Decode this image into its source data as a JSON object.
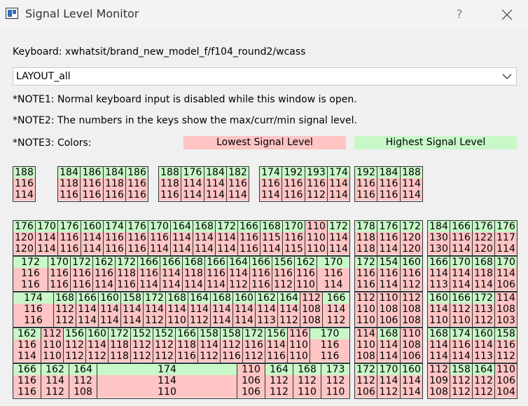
{
  "window": {
    "title": "Signal Level Monitor",
    "help_label": "?"
  },
  "keyboard_label": "Keyboard: xwhatsit/brand_new_model_f/f104_round2/wcass",
  "layout_select": {
    "value": "LAYOUT_all"
  },
  "notes": {
    "n1": "*NOTE1: Normal keyboard input is disabled while this window is open.",
    "n2": "*NOTE2: The numbers in the keys show the max/curr/min signal level.",
    "n3": "*NOTE3: Colors:"
  },
  "legend": {
    "lowest": "Lowest Signal Level",
    "highest": "Highest Signal Level",
    "low_color": "#ffc4c4",
    "high_color": "#c8f7c8"
  },
  "keys": [
    [
      18,
      237,
      32,
      "188",
      "116",
      "114"
    ],
    [
      82,
      237,
      32,
      "184",
      "118",
      "116"
    ],
    [
      114,
      237,
      33,
      "186",
      "116",
      "116"
    ],
    [
      147,
      237,
      32,
      "184",
      "118",
      "116"
    ],
    [
      179,
      237,
      32,
      "186",
      "116",
      "116"
    ],
    [
      226,
      237,
      32,
      "188",
      "118",
      "116"
    ],
    [
      258,
      237,
      33,
      "176",
      "114",
      "114"
    ],
    [
      291,
      237,
      32,
      "184",
      "114",
      "114"
    ],
    [
      323,
      237,
      32,
      "182",
      "116",
      "114"
    ],
    [
      370,
      237,
      32,
      "174",
      "116",
      "114"
    ],
    [
      402,
      237,
      33,
      "192",
      "116",
      "116"
    ],
    [
      435,
      237,
      32,
      "193",
      "116",
      "112"
    ],
    [
      467,
      237,
      32,
      "174",
      "114",
      "114"
    ],
    [
      506,
      237,
      32,
      "192",
      "116",
      "116"
    ],
    [
      538,
      237,
      33,
      "184",
      "116",
      "116"
    ],
    [
      571,
      237,
      32,
      "188",
      "114",
      "114"
    ],
    [
      18,
      314,
      32,
      "176",
      "120",
      "120"
    ],
    [
      50,
      314,
      32,
      "170",
      "114",
      "114"
    ],
    [
      82,
      314,
      33,
      "176",
      "116",
      "116"
    ],
    [
      115,
      314,
      32,
      "160",
      "114",
      "114"
    ],
    [
      147,
      314,
      32,
      "174",
      "116",
      "116"
    ],
    [
      179,
      314,
      32,
      "176",
      "116",
      "116"
    ],
    [
      211,
      314,
      32,
      "170",
      "116",
      "114"
    ],
    [
      243,
      314,
      32,
      "164",
      "114",
      "114"
    ],
    [
      275,
      314,
      32,
      "168",
      "114",
      "114"
    ],
    [
      307,
      314,
      32,
      "172",
      "114",
      "114"
    ],
    [
      339,
      314,
      32,
      "166",
      "116",
      "116"
    ],
    [
      371,
      314,
      32,
      "168",
      "115",
      "114"
    ],
    [
      403,
      314,
      32,
      "170",
      "116",
      "115"
    ],
    [
      435,
      314,
      32,
      "110",
      "110",
      "110"
    ],
    [
      467,
      314,
      32,
      "172",
      "114",
      "114"
    ],
    [
      506,
      314,
      32,
      "178",
      "118",
      "118"
    ],
    [
      538,
      314,
      33,
      "176",
      "116",
      "114"
    ],
    [
      571,
      314,
      32,
      "172",
      "120",
      "120"
    ],
    [
      610,
      314,
      32,
      "184",
      "130",
      "130"
    ],
    [
      642,
      314,
      32,
      "166",
      "116",
      "114"
    ],
    [
      674,
      314,
      32,
      "176",
      "122",
      "120"
    ],
    [
      706,
      314,
      32,
      "176",
      "117",
      "114"
    ],
    [
      18,
      365,
      50,
      "172",
      "116",
      "116"
    ],
    [
      68,
      365,
      32,
      "170",
      "116",
      "116"
    ],
    [
      100,
      365,
      32,
      "172",
      "116",
      "116"
    ],
    [
      132,
      365,
      32,
      "162",
      "116",
      "114"
    ],
    [
      164,
      365,
      32,
      "172",
      "118",
      "116"
    ],
    [
      196,
      365,
      32,
      "166",
      "116",
      "114"
    ],
    [
      228,
      365,
      32,
      "166",
      "114",
      "114"
    ],
    [
      260,
      365,
      32,
      "168",
      "118",
      "114"
    ],
    [
      292,
      365,
      32,
      "166",
      "116",
      "114"
    ],
    [
      324,
      365,
      32,
      "164",
      "114",
      "112"
    ],
    [
      356,
      365,
      32,
      "166",
      "116",
      "116"
    ],
    [
      388,
      365,
      32,
      "156",
      "116",
      "112"
    ],
    [
      420,
      365,
      32,
      "162",
      "116",
      "110"
    ],
    [
      452,
      365,
      47,
      "170",
      "116",
      "114"
    ],
    [
      506,
      365,
      32,
      "172",
      "116",
      "116"
    ],
    [
      538,
      365,
      33,
      "154",
      "116",
      "114"
    ],
    [
      571,
      365,
      32,
      "160",
      "116",
      "112"
    ],
    [
      610,
      365,
      32,
      "166",
      "114",
      "113"
    ],
    [
      642,
      365,
      32,
      "170",
      "114",
      "114"
    ],
    [
      674,
      365,
      32,
      "168",
      "118",
      "114"
    ],
    [
      706,
      365,
      32,
      "170",
      "114",
      "106"
    ],
    [
      18,
      416,
      58,
      "174",
      "116",
      "116"
    ],
    [
      76,
      416,
      32,
      "168",
      "112",
      "112"
    ],
    [
      108,
      416,
      32,
      "166",
      "114",
      "114"
    ],
    [
      140,
      416,
      32,
      "160",
      "114",
      "114"
    ],
    [
      172,
      416,
      32,
      "158",
      "114",
      "114"
    ],
    [
      204,
      416,
      32,
      "172",
      "114",
      "112"
    ],
    [
      236,
      416,
      32,
      "168",
      "114",
      "110"
    ],
    [
      268,
      416,
      32,
      "164",
      "114",
      "112"
    ],
    [
      300,
      416,
      32,
      "168",
      "114",
      "114"
    ],
    [
      332,
      416,
      32,
      "160",
      "114",
      "114"
    ],
    [
      364,
      416,
      32,
      "162",
      "114",
      "113"
    ],
    [
      396,
      416,
      32,
      "164",
      "114",
      "112"
    ],
    [
      428,
      416,
      32,
      "112",
      "108",
      "108"
    ],
    [
      460,
      416,
      39,
      "166",
      "114",
      "112"
    ],
    [
      506,
      416,
      32,
      "112",
      "110",
      "110"
    ],
    [
      538,
      416,
      33,
      "110",
      "108",
      "106"
    ],
    [
      571,
      416,
      32,
      "112",
      "108",
      "108"
    ],
    [
      610,
      416,
      32,
      "160",
      "114",
      "110"
    ],
    [
      642,
      416,
      32,
      "166",
      "112",
      "110"
    ],
    [
      674,
      416,
      32,
      "172",
      "113",
      "112"
    ],
    [
      706,
      416,
      32,
      "114",
      "108",
      "103"
    ],
    [
      18,
      467,
      40,
      "162",
      "116",
      "114"
    ],
    [
      58,
      467,
      32,
      "112",
      "110",
      "110"
    ],
    [
      90,
      467,
      32,
      "156",
      "112",
      "112"
    ],
    [
      122,
      467,
      32,
      "160",
      "114",
      "112"
    ],
    [
      154,
      467,
      32,
      "172",
      "118",
      "118"
    ],
    [
      186,
      467,
      32,
      "152",
      "112",
      "112"
    ],
    [
      218,
      467,
      32,
      "152",
      "112",
      "112"
    ],
    [
      250,
      467,
      32,
      "166",
      "118",
      "116"
    ],
    [
      282,
      467,
      32,
      "158",
      "114",
      "112"
    ],
    [
      314,
      467,
      32,
      "158",
      "112",
      "116"
    ],
    [
      346,
      467,
      32,
      "172",
      "116",
      "112"
    ],
    [
      378,
      467,
      32,
      "156",
      "114",
      "116"
    ],
    [
      410,
      467,
      32,
      "116",
      "110",
      "110"
    ],
    [
      442,
      467,
      57,
      "170",
      "116",
      "116"
    ],
    [
      506,
      467,
      32,
      "114",
      "110",
      "108"
    ],
    [
      538,
      467,
      33,
      "168",
      "114",
      "114"
    ],
    [
      571,
      467,
      32,
      "110",
      "108",
      "106"
    ],
    [
      610,
      467,
      32,
      "168",
      "114",
      "114"
    ],
    [
      642,
      467,
      32,
      "174",
      "116",
      "114"
    ],
    [
      674,
      467,
      32,
      "160",
      "114",
      "113"
    ],
    [
      706,
      467,
      32,
      "158",
      "116",
      "112"
    ],
    [
      18,
      518,
      40,
      "166",
      "116",
      "116"
    ],
    [
      58,
      518,
      40,
      "162",
      "114",
      "112"
    ],
    [
      98,
      518,
      40,
      "164",
      "112",
      "108"
    ],
    [
      138,
      518,
      200,
      "174",
      "114",
      "110"
    ],
    [
      338,
      518,
      40,
      "110",
      "106",
      "106"
    ],
    [
      378,
      518,
      40,
      "164",
      "112",
      "112"
    ],
    [
      418,
      518,
      40,
      "168",
      "112",
      "110"
    ],
    [
      458,
      518,
      41,
      "173",
      "112",
      "110"
    ],
    [
      506,
      518,
      32,
      "172",
      "112",
      "106"
    ],
    [
      538,
      518,
      33,
      "170",
      "114",
      "112"
    ],
    [
      571,
      518,
      32,
      "160",
      "114",
      "114"
    ],
    [
      610,
      518,
      32,
      "112",
      "109",
      "108"
    ],
    [
      642,
      518,
      32,
      "158",
      "112",
      "112"
    ],
    [
      674,
      518,
      32,
      "164",
      "112",
      "112"
    ],
    [
      706,
      518,
      32,
      "110",
      "106",
      "104"
    ]
  ]
}
